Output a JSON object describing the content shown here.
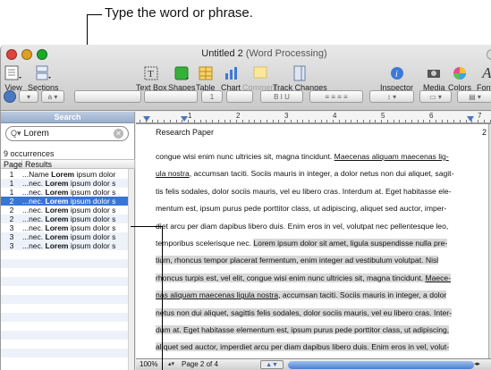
{
  "callout": {
    "text": "Type the word or phrase."
  },
  "window": {
    "title": "Untitled 2",
    "subtitle": "(Word Processing)",
    "colors": {
      "close": "#e0443e",
      "minimize": "#dea123",
      "zoom": "#1aab29",
      "selection": "#3875d7"
    }
  },
  "toolbar": {
    "view": {
      "label": "View",
      "icon": "view-icon"
    },
    "sections": {
      "label": "Sections",
      "icon": "sections-icon"
    },
    "textbox": {
      "label": "Text Box",
      "icon": "textbox-icon"
    },
    "shapes": {
      "label": "Shapes",
      "icon": "shapes-icon"
    },
    "table": {
      "label": "Table",
      "icon": "table-icon"
    },
    "chart": {
      "label": "Chart",
      "icon": "chart-icon"
    },
    "comment": {
      "label": "Comment",
      "icon": "comment-icon"
    },
    "track_changes": {
      "label": "Track Changes",
      "icon": "track-changes-icon"
    },
    "inspector": {
      "label": "Inspector",
      "icon": "inspector-icon"
    },
    "media": {
      "label": "Media",
      "icon": "media-icon"
    },
    "colors": {
      "label": "Colors",
      "icon": "colors-icon"
    },
    "fonts": {
      "label": "Fonts",
      "icon": "fonts-icon"
    }
  },
  "formatbar": {
    "font_size": "1"
  },
  "search": {
    "header": "Search",
    "query": "Lorem",
    "occurrences": "9 occurrences",
    "columns": {
      "page": "Page",
      "results": "Results"
    },
    "results": [
      {
        "page": "1",
        "pre": "...Name ",
        "match": "Lorem",
        "post": " ipsum dolor"
      },
      {
        "page": "1",
        "pre": "...nec. ",
        "match": "Lorem",
        "post": " ipsum dolor s"
      },
      {
        "page": "1",
        "pre": "...nec. ",
        "match": "Lorem",
        "post": " ipsum dolor s"
      },
      {
        "page": "2",
        "pre": "...nec. ",
        "match": "Lorem",
        "post": " ipsum dolor s"
      },
      {
        "page": "2",
        "pre": "...nec. ",
        "match": "Lorem",
        "post": " ipsum dolor s"
      },
      {
        "page": "2",
        "pre": "...nec. ",
        "match": "Lorem",
        "post": " ipsum dolor s"
      },
      {
        "page": "3",
        "pre": "...nec. ",
        "match": "Lorem",
        "post": " ipsum dolor s"
      },
      {
        "page": "3",
        "pre": "...nec. ",
        "match": "Lorem",
        "post": " ipsum dolor s"
      },
      {
        "page": "3",
        "pre": "...nec. ",
        "match": "Lorem",
        "post": " ipsum dolor s"
      }
    ],
    "selected_index": 3
  },
  "ruler": {
    "numbers": [
      "1",
      "2",
      "3",
      "4",
      "5",
      "6",
      "7"
    ]
  },
  "document": {
    "header_title": "Research Paper",
    "page_number": "2",
    "lines": [
      [
        {
          "t": "congue wisi enim nunc ultricies sit, magna tincidunt. "
        },
        {
          "t": "Maecenas aliquam maecenas lig-",
          "u": true
        }
      ],
      [
        {
          "t": "ula nostra",
          "u": true
        },
        {
          "t": ", accumsan taciti. Sociis mauris in integer, a dolor netus non dui aliquet, sagit-"
        }
      ],
      [
        {
          "t": "tis felis sodales, dolor sociis mauris, vel eu libero cras. Interdum at. Eget habitasse ele-"
        }
      ],
      [
        {
          "t": "mentum est, ipsum purus pede porttitor class, ut adipiscing, aliquet sed auctor, imper-"
        }
      ],
      [
        {
          "t": "diet arcu per diam dapibus libero duis. Enim eros in vel, volutpat nec pellentesque leo,"
        }
      ],
      [
        {
          "t": "temporibus scelerisque nec. "
        },
        {
          "t": "Lorem ipsum dolor sit amet, ligula suspendisse nulla pre-",
          "h": true
        }
      ],
      [
        {
          "t": "tium, rhoncus tempor placerat fermentum, enim integer ad vestibulum volutpat. Nisl",
          "h": true
        }
      ],
      [
        {
          "t": "rhoncus turpis est, vel elit, congue wisi enim nunc ultricies sit, magna tincidunt. ",
          "h": true
        },
        {
          "t": "Maece-",
          "h": true,
          "u": true
        }
      ],
      [
        {
          "t": "nas aliquam maecenas ligula nostra",
          "h": true,
          "u": true
        },
        {
          "t": ", accumsan taciti. Sociis mauris in integer, a dolor",
          "h": true
        }
      ],
      [
        {
          "t": "netus non dui aliquet, sagittis felis sodales, dolor sociis mauris, vel eu libero cras. Inter-",
          "h": true
        }
      ],
      [
        {
          "t": "dum at. Eget habitasse elementum est, ipsum purus pede porttitor class, ut adipiscing,",
          "h": true
        }
      ],
      [
        {
          "t": "aliquet sed auctor, imperdiet arcu per diam dapibus libero duis. Enim eros in vel, volut-",
          "h": true
        }
      ],
      [
        {
          "t": "pat nec pellentesque leo, temporibus scelerisque nec. ",
          "h": true
        },
        {
          "t": "Lorem ipsum dolor sit amet, lig-"
        }
      ]
    ]
  },
  "status": {
    "zoom": "100%",
    "page": "Page 2 of 4"
  }
}
